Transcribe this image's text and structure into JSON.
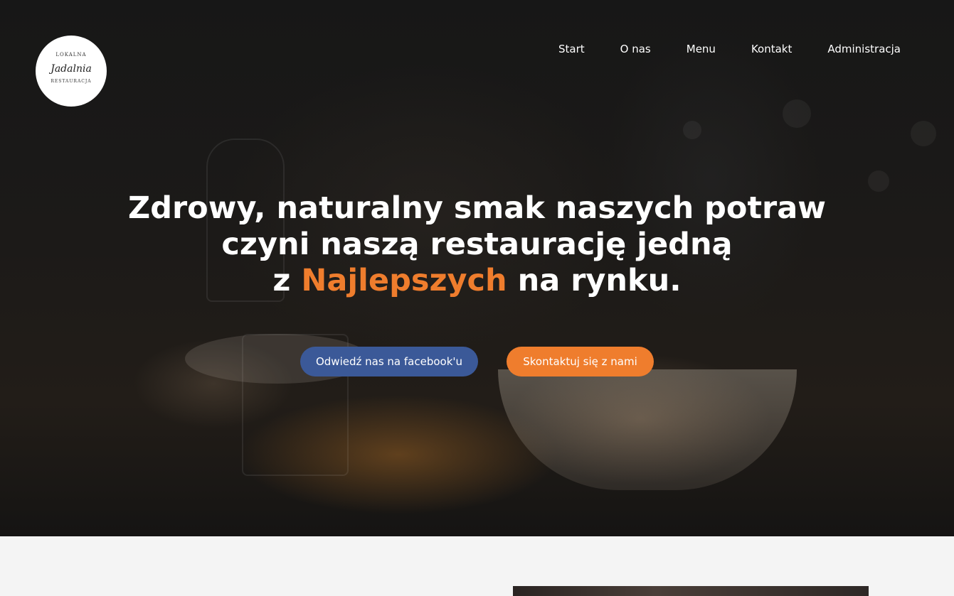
{
  "logo": {
    "top_text": "LOKALNA",
    "script_text": "Jadalnia",
    "bottom_text": "RESTAURACJA"
  },
  "nav": {
    "items": [
      "Start",
      "O nas",
      "Menu",
      "Kontakt",
      "Administracja"
    ]
  },
  "hero": {
    "line1": "Zdrowy, naturalny smak naszych potraw",
    "line2": "czyni naszą restaurację jedną",
    "line3_prefix": "z",
    "line3_accent": "Najlepszych",
    "line3_suffix": "na rynku.",
    "accent_color": "#ef7d2d"
  },
  "buttons": {
    "facebook": "Odwiedź nas na facebook'u",
    "contact": "Skontaktuj się z nami",
    "facebook_color": "#3b5998",
    "contact_color": "#ef7d2d"
  }
}
